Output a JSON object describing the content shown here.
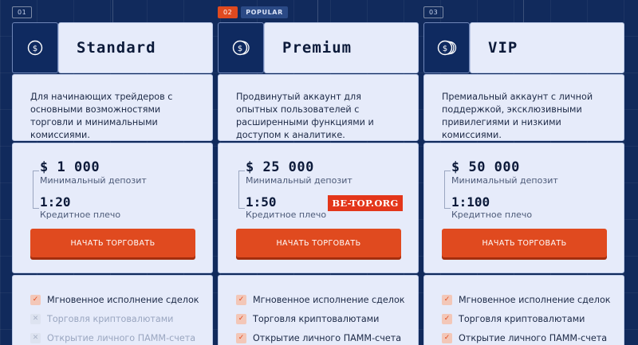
{
  "plans": [
    {
      "num": "01",
      "popular": "",
      "name": "Standard",
      "description": "Для начинающих трейдеров с основными возможностями торговли и минимальными комиссиями.",
      "deposit": "$ 1 000",
      "deposit_label": "Минимальный депозит",
      "leverage": "1:20",
      "leverage_label": "Кредитное плечо",
      "cta": "НАЧАТЬ ТОРГОВАТЬ",
      "features": [
        {
          "label": "Мгновенное исполнение сделок",
          "enabled": true
        },
        {
          "label": "Торговля криптовалютами",
          "enabled": false
        },
        {
          "label": "Открытие личного ПАММ-счета",
          "enabled": false
        }
      ]
    },
    {
      "num": "02",
      "popular": "POPULAR",
      "name": "Premium",
      "description": "Продвинутый аккаунт для опытных пользователей с расширенными функциями и доступом к аналитике.",
      "deposit": "$ 25 000",
      "deposit_label": "Минимальный депозит",
      "leverage": "1:50",
      "leverage_label": "Кредитное плечо",
      "cta": "НАЧАТЬ ТОРГОВАТЬ",
      "features": [
        {
          "label": "Мгновенное исполнение сделок",
          "enabled": true
        },
        {
          "label": "Торговля криптовалютами",
          "enabled": true
        },
        {
          "label": "Открытие личного ПАММ-счета",
          "enabled": true
        }
      ]
    },
    {
      "num": "03",
      "popular": "",
      "name": "VIP",
      "description": "Премиальный аккаунт с личной поддержкой, эксклюзивными привилегиями и низкими комиссиями.",
      "deposit": "$ 50 000",
      "deposit_label": "Минимальный депозит",
      "leverage": "1:100",
      "leverage_label": "Кредитное плечо",
      "cta": "НАЧАТЬ ТОРГОВАТЬ",
      "features": [
        {
          "label": "Мгновенное исполнение сделок",
          "enabled": true
        },
        {
          "label": "Торговля криптовалютами",
          "enabled": true
        },
        {
          "label": "Открытие личного ПАММ-счета",
          "enabled": true
        }
      ]
    }
  ],
  "watermark": "BE-TOP.ORG",
  "icons": {
    "plan_1": "coin-icon",
    "plan_2": "coins-stack-icon",
    "plan_3": "coins-stack-large-icon",
    "feature_on": "check-icon",
    "feature_off": "cross-icon"
  },
  "colors": {
    "background": "#112a5c",
    "card": "#e6ebfa",
    "accent": "#e04a1f",
    "text": "#0c1a3a"
  }
}
